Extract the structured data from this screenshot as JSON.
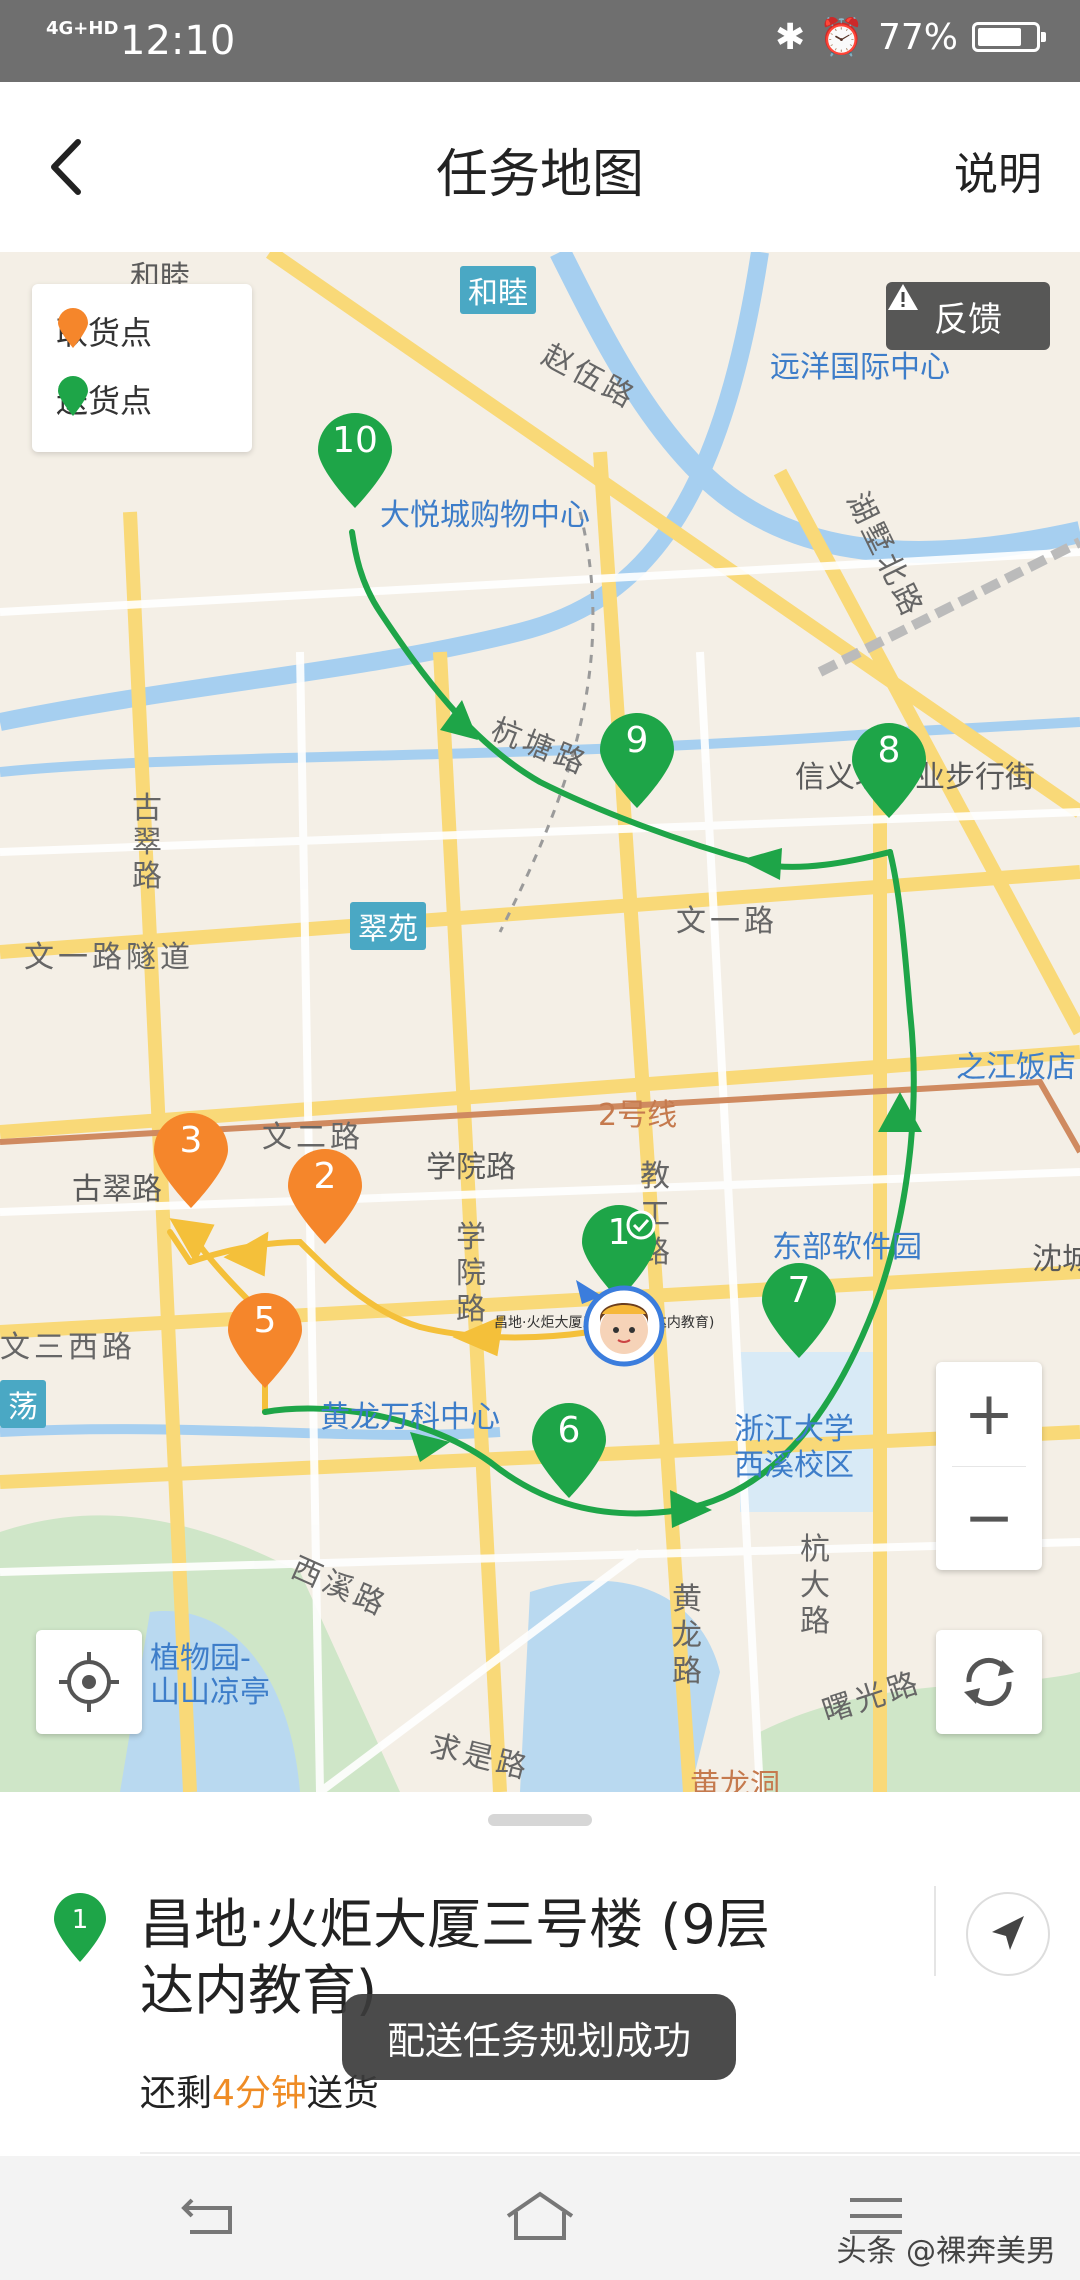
{
  "status_bar": {
    "network": "4G+HD",
    "time": "12:10",
    "battery": "77%",
    "battery_level": 0.77
  },
  "header": {
    "title": "任务地图",
    "help_label": "说明"
  },
  "legend": {
    "pickup_label": "取货点",
    "delivery_label": "送货点",
    "pickup_color": "#f5862b",
    "delivery_color": "#1ea548"
  },
  "feedback_label": "反馈",
  "map_labels": {
    "heshi_top": "和睦",
    "heshi_station": "和睦",
    "zhaowu_road": "赵伍路",
    "yuanyang": "远洋国际中心",
    "dayue": "大悦城购物中心",
    "hushu_road": "湖墅北路",
    "hangtang_road": "杭塘路",
    "xinyi_street": "信义坊商业步行街",
    "gucui_road": "古翠路",
    "cuiyuan": "翠苑",
    "wenyi_tunnel": "文一路隧道",
    "wenyi_road": "文一路",
    "zhijiang_hotel": "之江饭店",
    "line2": "2号线",
    "wener_road": "文二路",
    "xueyuan_road_h": "学院路",
    "gucui_station": "古翠路",
    "jiaogong_road": "教工路",
    "dongbu_park": "东部软件园",
    "shencheng": "沈城",
    "xueyuan_road_v": "学院路",
    "wensan_road": "文三西路",
    "dang": "荡",
    "huanglong_tech": "黄龙万科中心",
    "zju": "浙江大学\n西溪校区",
    "xixi_road": "西溪路",
    "botanic": "植物园-\n山山凉亭",
    "huanglong_road": "黄龙路",
    "hangda_road": "杭大路",
    "shuguang_road": "曙光路",
    "qiushi_road": "求是路",
    "huanglong_cave": "黄龙洞",
    "current_loc_label": "昌地·火炬大厦三号楼(9层达内教育)"
  },
  "markers": [
    {
      "num": "1",
      "type": "delivery"
    },
    {
      "num": "2",
      "type": "pickup"
    },
    {
      "num": "3",
      "type": "pickup"
    },
    {
      "num": "5",
      "type": "pickup"
    },
    {
      "num": "6",
      "type": "delivery"
    },
    {
      "num": "7",
      "type": "delivery"
    },
    {
      "num": "8",
      "type": "delivery"
    },
    {
      "num": "9",
      "type": "delivery"
    },
    {
      "num": "10",
      "type": "delivery"
    }
  ],
  "zoom": {
    "in": "+",
    "out": "−"
  },
  "icons": {
    "back": "chevron-left-icon",
    "warning": "warning-icon",
    "locate": "locate-icon",
    "refresh": "refresh-icon",
    "navigate": "navigate-arrow-icon"
  },
  "toast": "配送任务规划成功",
  "bottom_sheet": {
    "pin_num": "1",
    "title": "昌地·火炬大厦三号楼 (9层达内教育)",
    "remain_prefix": "还剩",
    "remain_time": "4分钟",
    "remain_suffix": "送货"
  },
  "watermark": "头条 @裸奔美男"
}
